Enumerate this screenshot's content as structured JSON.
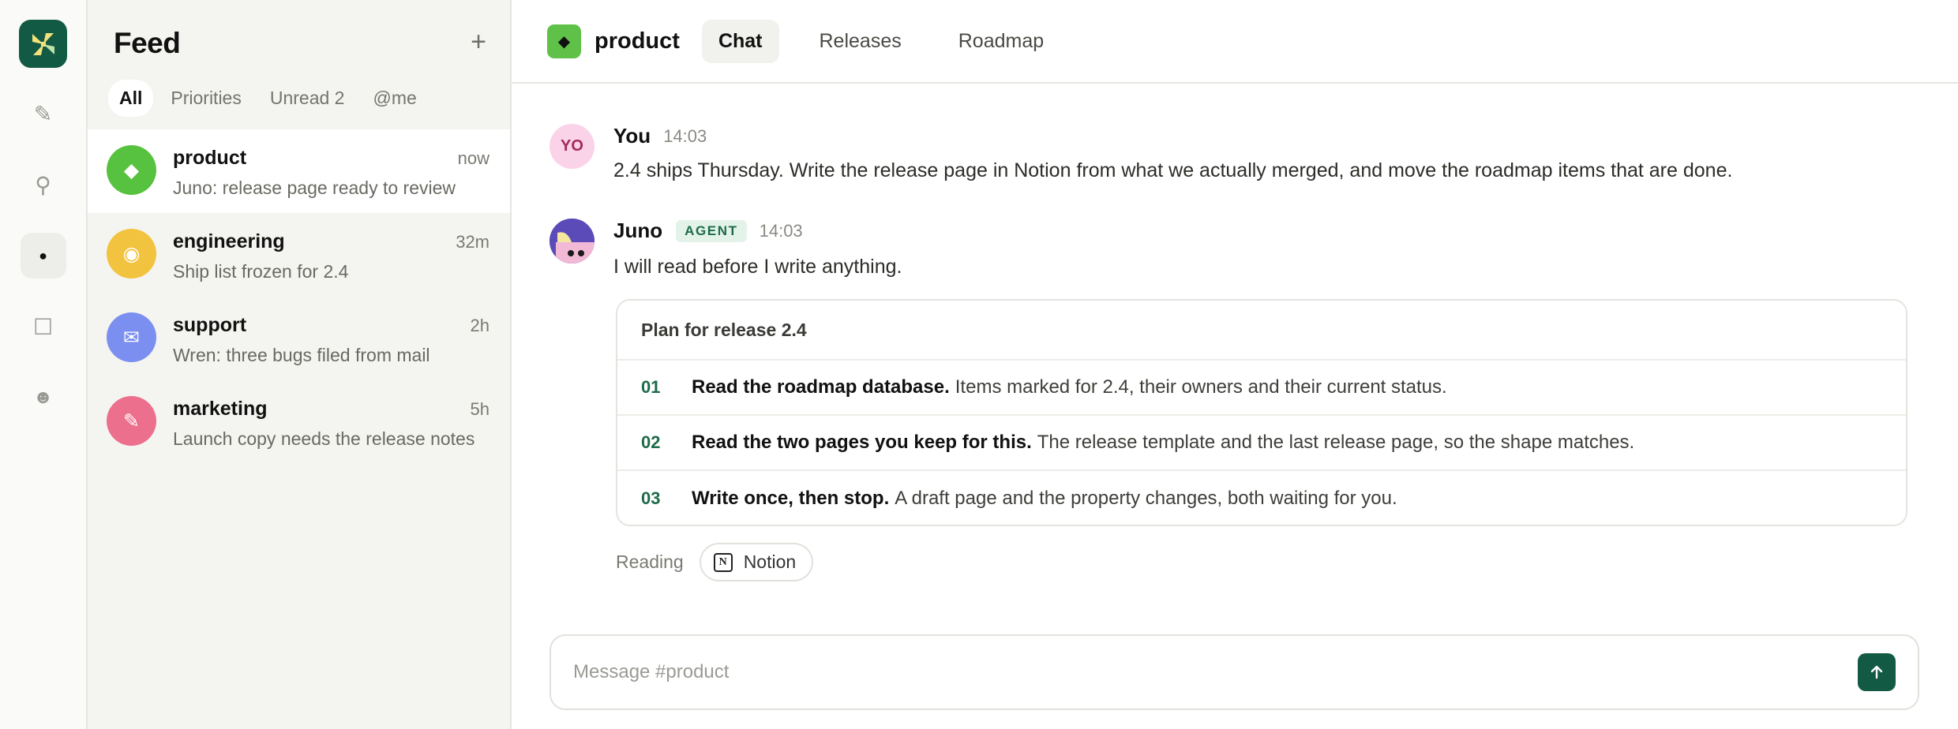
{
  "rail": {
    "items": [
      {
        "name": "compose-icon",
        "glyph": "✎"
      },
      {
        "name": "pin-icon",
        "glyph": "⚲"
      },
      {
        "name": "dot-icon",
        "glyph": "●"
      },
      {
        "name": "square-icon",
        "glyph": "☐"
      },
      {
        "name": "face-icon",
        "glyph": "☻"
      }
    ],
    "active_index": 2
  },
  "feed": {
    "title": "Feed",
    "add_label": "+",
    "filters": [
      "All",
      "Priorities",
      "Unread 2",
      "@me"
    ],
    "active_filter": 0,
    "conversations": [
      {
        "name": "product",
        "preview": "Juno: release page ready to review",
        "time": "now",
        "color": "#57c23f",
        "glyph": "◆"
      },
      {
        "name": "engineering",
        "preview": "Ship list frozen for 2.4",
        "time": "32m",
        "color": "#f2c33e",
        "glyph": "◉"
      },
      {
        "name": "support",
        "preview": "Wren: three bugs filed from mail",
        "time": "2h",
        "color": "#7b8ff0",
        "glyph": "✉"
      },
      {
        "name": "marketing",
        "preview": "Launch copy needs the release notes",
        "time": "5h",
        "color": "#ec6f8d",
        "glyph": "✎"
      }
    ]
  },
  "channel": {
    "name": "product",
    "icon_glyph": "◆",
    "tabs": [
      "Chat",
      "Releases",
      "Roadmap"
    ],
    "active_tab": 0
  },
  "messages": [
    {
      "avatar_text": "YO",
      "author": "You",
      "time": "14:03",
      "text": "2.4 ships Thursday. Write the release page in Notion from what we actually merged, and move the roadmap items that are done."
    },
    {
      "author": "Juno",
      "badge": "AGENT",
      "time": "14:03",
      "text": "I will read before I write anything."
    }
  ],
  "plan": {
    "title": "Plan for release 2.4",
    "steps": [
      {
        "num": "01",
        "strong": "Read the roadmap database.",
        "rest": "Items marked for 2.4, their owners and their current status."
      },
      {
        "num": "02",
        "strong": "Read the two pages you keep for this.",
        "rest": "The release template and the last release page, so the shape matches."
      },
      {
        "num": "03",
        "strong": "Write once, then stop.",
        "rest": "A draft page and the property changes, both waiting for you."
      }
    ]
  },
  "reading": {
    "label": "Reading",
    "source": "Notion",
    "source_glyph": "N"
  },
  "composer": {
    "placeholder": "Message #product"
  },
  "colors": {
    "brand": "#135a45",
    "agent_badge_bg": "#e3f3ea",
    "agent_badge_fg": "#1d6b4a"
  }
}
